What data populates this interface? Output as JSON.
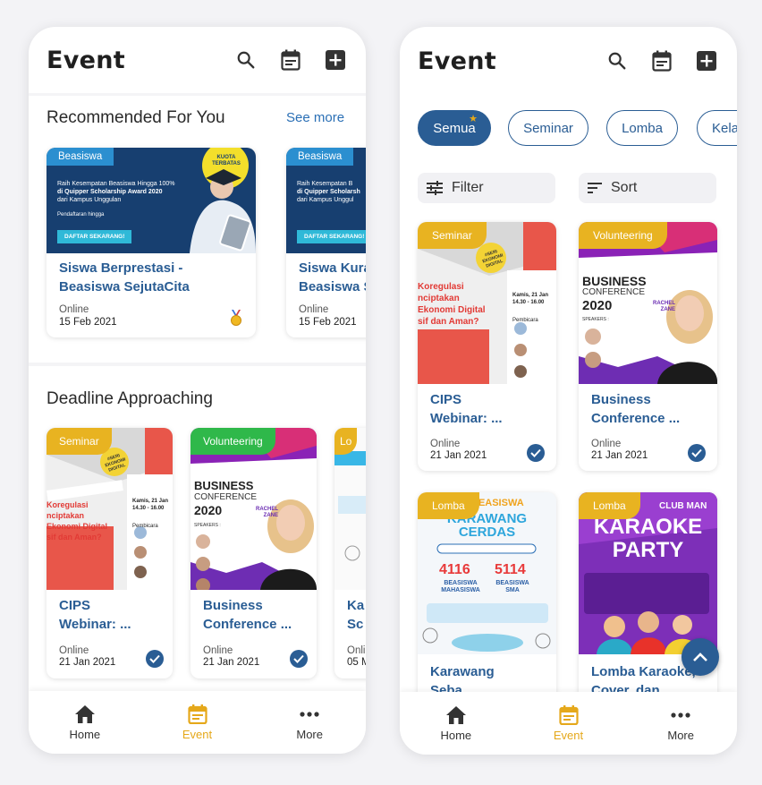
{
  "colors": {
    "primary": "#2a5d94",
    "accent": "#e5a81a",
    "seminar_badge": "#e8b321",
    "volunteering_badge": "#2fb84a",
    "beasiswa_badge": "#2b8fd0"
  },
  "left": {
    "header": {
      "title": "Event"
    },
    "recommended": {
      "title": "Recommended For You",
      "see_more": "See more",
      "cards": [
        {
          "badge": "Beasiswa",
          "banner_line1": "Raih Kesempatan Beasiswa Hingga 100%",
          "banner_line2": "di Quipper Scholarship Award 2020",
          "banner_line3": "dari Kampus Unggulan",
          "banner_cta": "DAFTAR SEKARANG!",
          "banner_reg": "Pendaftaran hingga",
          "ribbon": "KUOTA TERBATAS",
          "title_line1": "Siswa Berprestasi -",
          "title_line2": "Beasiswa SejutaCita",
          "mode": "Online",
          "date": "15 Feb 2021",
          "icon": "medal-icon"
        },
        {
          "badge": "Beasiswa",
          "banner_line1": "Raih Kesempatan B",
          "banner_line2": "di Quipper Scholarsh",
          "banner_line3": "dari Kampus Unggul",
          "banner_cta": "DAFTAR SEKARANG!",
          "title_line1": "Siswa Kura",
          "title_line2": "Beasiswa S",
          "mode": "Online",
          "date": "15 Feb 2021"
        }
      ]
    },
    "deadline": {
      "title": "Deadline Approaching",
      "cards": [
        {
          "badge": "Seminar",
          "title_line1": "CIPS",
          "title_line2": "Webinar: ...",
          "mode": "Online",
          "date": "21 Jan 2021"
        },
        {
          "badge": "Volunteering",
          "title_line1": "Business",
          "title_line2": "Conference ...",
          "mode": "Online",
          "date": "21 Jan 2021"
        },
        {
          "badge": "Lo",
          "title_line1": "Ka",
          "title_line2": "Sc",
          "mode": "Onli",
          "date": "05 M"
        }
      ]
    },
    "nav": [
      {
        "label": "Home",
        "icon": "home-icon"
      },
      {
        "label": "Event",
        "icon": "calendar-icon"
      },
      {
        "label": "More",
        "icon": "more-icon"
      }
    ]
  },
  "right": {
    "header": {
      "title": "Event"
    },
    "chips": [
      "Semua",
      "Seminar",
      "Lomba",
      "Kela"
    ],
    "filter_label": "Filter",
    "sort_label": "Sort",
    "grid": [
      {
        "badge": "Seminar",
        "title_line1": "CIPS",
        "title_line2": "Webinar: ...",
        "mode": "Online",
        "date": "21 Jan 2021"
      },
      {
        "badge": "Volunteering",
        "title_line1": "Business",
        "title_line2": "Conference ...",
        "mode": "Online",
        "date": "21 Jan 2021"
      },
      {
        "badge": "Lomba",
        "title_line1": "Karawang",
        "title_line2": "Seba"
      },
      {
        "badge": "Lomba",
        "title_line1": "Lomba Karaoke,",
        "title_line2": "Cover, dan"
      }
    ],
    "nav": [
      {
        "label": "Home",
        "icon": "home-icon"
      },
      {
        "label": "Event",
        "icon": "calendar-icon"
      },
      {
        "label": "More",
        "icon": "more-icon"
      }
    ]
  },
  "poster_text": {
    "seminar_tag": "#SERI EKONOMI DIGITAL",
    "seminar_lines": [
      "Koregulasi",
      "nciptakan",
      "Ekonomi Digital",
      "sif dan Aman?"
    ],
    "seminar_side": "Kamis, 21 Jan",
    "seminar_time": "14.30 - 16.00",
    "seminar_speaker": "Pembicara",
    "business_title": "BUSINESS",
    "business_sub": "CONFERENCE",
    "business_year": "2020",
    "business_name": "RACHEL ZANE",
    "business_speakers": "SPEAKERS :",
    "karawang_top": "BEASISWA",
    "karawang_main": "KARAWANG CERDAS",
    "karawang_num1": "4116",
    "karawang_num2": "5114",
    "karawang_lbl1": "BEASISWA MAHASISWA",
    "karawang_lbl2": "BEASISWA SMA",
    "karaoke_top": "CLUB MAN",
    "karaoke_main1": "KARAOKE",
    "karaoke_main2": "PARTY"
  }
}
